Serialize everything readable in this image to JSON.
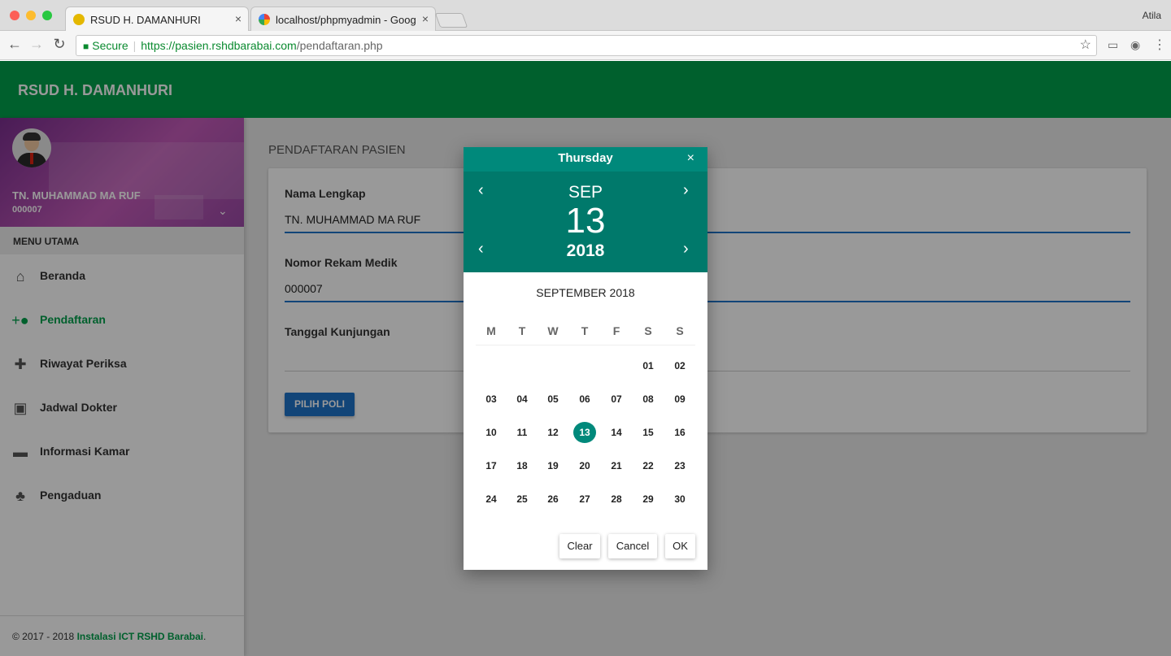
{
  "browser": {
    "tabs": [
      {
        "title": "RSUD H. DAMANHURI",
        "close": "×"
      },
      {
        "title": "localhost/phpmyadmin - Goog",
        "close": "×"
      }
    ],
    "profile": "Atila",
    "address": {
      "secure_label": "Secure",
      "host": "https://pasien.rshdbarabai.com",
      "path": "/pendaftaran.php"
    }
  },
  "app": {
    "brand": "RSUD H. DAMANHURI",
    "colors": {
      "appbar": "#00a14b",
      "accent": "#1e73c9",
      "picker_header": "#00796b"
    }
  },
  "sidebar": {
    "user_name": "TN. MUHAMMAD MA RUF",
    "user_id": "000007",
    "menu_header": "MENU UTAMA",
    "items": [
      {
        "label": "Beranda",
        "icon": "home-icon",
        "active": false
      },
      {
        "label": "Pendaftaran",
        "icon": "person-add-icon",
        "active": true
      },
      {
        "label": "Riwayat Periksa",
        "icon": "medical-history-icon",
        "active": false
      },
      {
        "label": "Jadwal Dokter",
        "icon": "calendar-check-icon",
        "active": false
      },
      {
        "label": "Informasi Kamar",
        "icon": "bed-icon",
        "active": false
      },
      {
        "label": "Pengaduan",
        "icon": "bell-plus-icon",
        "active": false
      }
    ],
    "footer_prefix": "© 2017 - 2018 ",
    "footer_link": "Instalasi ICT RSHD Barabai",
    "footer_suffix": "."
  },
  "main": {
    "title": "PENDAFTARAN PASIEN",
    "fields": [
      {
        "label": "Nama Lengkap",
        "value": "TN. MUHAMMAD MA RUF"
      },
      {
        "label": "Nomor Rekam Medik",
        "value": "000007"
      },
      {
        "label": "Tanggal Kunjungan",
        "value": ""
      }
    ],
    "button": "PILIH POLI"
  },
  "datepicker": {
    "weekday": "Thursday",
    "close": "×",
    "month": "SEP",
    "date": "13",
    "year": "2018",
    "caption": "SEPTEMBER 2018",
    "weekday_headers": [
      "M",
      "T",
      "W",
      "T",
      "F",
      "S",
      "S"
    ],
    "weeks": [
      [
        "",
        "",
        "",
        "",
        "",
        "01",
        "02"
      ],
      [
        "03",
        "04",
        "05",
        "06",
        "07",
        "08",
        "09"
      ],
      [
        "10",
        "11",
        "12",
        "13",
        "14",
        "15",
        "16"
      ],
      [
        "17",
        "18",
        "19",
        "20",
        "21",
        "22",
        "23"
      ],
      [
        "24",
        "25",
        "26",
        "27",
        "28",
        "29",
        "30"
      ]
    ],
    "selected": "13",
    "buttons": {
      "clear": "Clear",
      "cancel": "Cancel",
      "ok": "OK"
    }
  }
}
